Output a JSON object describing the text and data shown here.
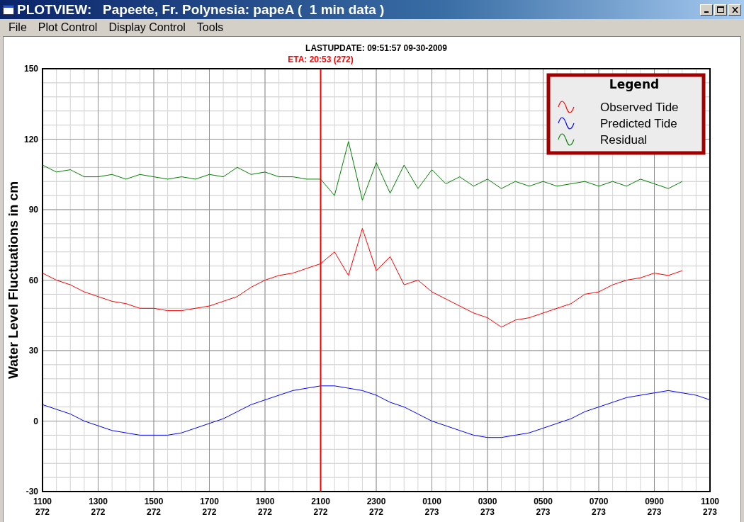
{
  "window": {
    "title": "PLOTVIEW:   Papeete, Fr. Polynesia: papeA (  1 min data )"
  },
  "menu": [
    "File",
    "Plot Control",
    "Display Control",
    "Tools"
  ],
  "chart": {
    "chart_data": {
      "type": "line",
      "title": "LASTUPDATE: 09:51:57  09-30-2009",
      "ylabel": "Water Level Fluctuations in cm",
      "categories": [
        "1100\n272",
        null,
        null,
        null,
        "1300\n272",
        null,
        null,
        null,
        "1500\n272",
        null,
        null,
        null,
        "1700\n272",
        null,
        null,
        null,
        "1900\n272",
        null,
        null,
        null,
        "2100\n272",
        null,
        null,
        null,
        "2300\n272",
        null,
        null,
        null,
        "0100\n273",
        null,
        null,
        null,
        "0300\n273",
        null,
        null,
        null,
        "0500\n273",
        null,
        null,
        null,
        "0700\n273",
        null,
        null,
        null,
        "0900\n273",
        null,
        null,
        null,
        "1100\n273"
      ],
      "series": [
        {
          "name": "Observed Tide",
          "color": "#ff0000",
          "values": [
            63,
            60,
            58,
            55,
            53,
            51,
            50,
            48,
            48,
            47,
            47,
            48,
            49,
            51,
            53,
            57,
            60,
            62,
            63,
            65,
            67,
            72,
            62,
            82,
            64,
            70,
            58,
            60,
            55,
            52,
            49,
            46,
            44,
            40,
            43,
            44,
            46,
            48,
            50,
            54,
            55,
            58,
            60,
            61,
            63,
            62,
            64,
            null,
            null
          ]
        },
        {
          "name": "Predicted Tide",
          "color": "#0000ff",
          "values": [
            7,
            5,
            3,
            0,
            -2,
            -4,
            -5,
            -6,
            -6,
            -6,
            -5,
            -3,
            -1,
            1,
            4,
            7,
            9,
            11,
            13,
            14,
            15,
            15,
            14,
            13,
            11,
            8,
            6,
            3,
            0,
            -2,
            -4,
            -6,
            -7,
            -7,
            -6,
            -5,
            -3,
            -1,
            1,
            4,
            6,
            8,
            10,
            11,
            12,
            13,
            12,
            11,
            9
          ]
        },
        {
          "name": "Residual",
          "color": "#008000",
          "values": [
            109,
            106,
            107,
            104,
            104,
            105,
            103,
            105,
            104,
            103,
            104,
            103,
            105,
            104,
            108,
            105,
            106,
            104,
            104,
            103,
            103,
            96,
            119,
            94,
            110,
            97,
            109,
            99,
            107,
            101,
            104,
            100,
            103,
            99,
            102,
            100,
            102,
            100,
            101,
            102,
            100,
            102,
            100,
            103,
            101,
            99,
            102,
            null,
            null
          ]
        }
      ],
      "ylim": [
        -30,
        150
      ],
      "yticks": [
        -30,
        0,
        30,
        60,
        90,
        120,
        150
      ],
      "grid": true,
      "legend": {
        "title": "Legend"
      },
      "annotations": [
        {
          "x": "2100\n272",
          "text": "ETA: 20:53 (272)"
        }
      ]
    }
  }
}
